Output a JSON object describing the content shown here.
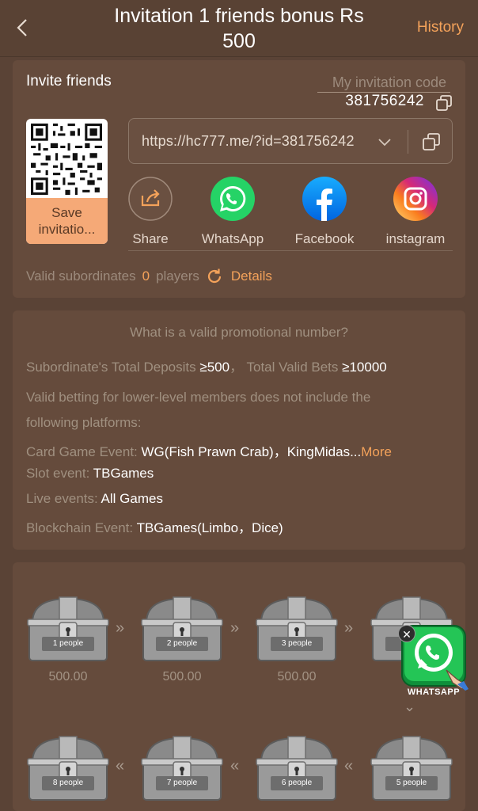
{
  "header": {
    "title": "Invitation 1 friends bonus Rs 500",
    "history": "History"
  },
  "invite": {
    "title": "Invite friends",
    "code_label": "My invitation code",
    "code_value": "381756242",
    "save_line1": "Save",
    "save_line2": "invitatio...",
    "link": "https://hc777.me/?id=381756242",
    "share_items": [
      {
        "label": "Share",
        "icon": "share-icon"
      },
      {
        "label": "WhatsApp",
        "icon": "whatsapp-icon"
      },
      {
        "label": "Facebook",
        "icon": "facebook-icon"
      },
      {
        "label": "instagram",
        "icon": "instagram-icon"
      }
    ],
    "valid_label": "Valid subordinates",
    "valid_count": "0",
    "valid_unit": "players",
    "details": "Details"
  },
  "promo": {
    "title": "What is a valid promotional number?",
    "deposits_label": "Subordinate's Total Deposits",
    "deposits_value": "≥500",
    "bets_label": "Total Valid Bets",
    "bets_value": "≥10000",
    "exclusion_line1": "Valid betting for lower-level members does not include the",
    "exclusion_line2": "following platforms:",
    "card_label": "Card Game Event:",
    "card_value": "WG(Fish Prawn Crab)，KingMidas...",
    "card_more": "More",
    "slot_label": "Slot event:",
    "slot_value": "TBGames",
    "live_label": "Live events:",
    "live_value": "All Games",
    "chain_label": "Blockchain Event:",
    "chain_value": "TBGames(Limbo，Dice)"
  },
  "rewards": {
    "row1": [
      {
        "label": "1 people",
        "amount": "500.00"
      },
      {
        "label": "2 people",
        "amount": "500.00"
      },
      {
        "label": "3 people",
        "amount": "500.00"
      },
      {
        "label": "4",
        "amount": "50"
      }
    ],
    "row2": [
      {
        "label": "8 people"
      },
      {
        "label": "7 people"
      },
      {
        "label": "6 people"
      },
      {
        "label": "5 people"
      }
    ]
  },
  "floating": {
    "label": "WHATSAPP",
    "close": "✕"
  },
  "colors": {
    "background": "#5a4336",
    "card": "#654b3c",
    "accent": "#f4a25a",
    "save_button": "#f5a977"
  }
}
